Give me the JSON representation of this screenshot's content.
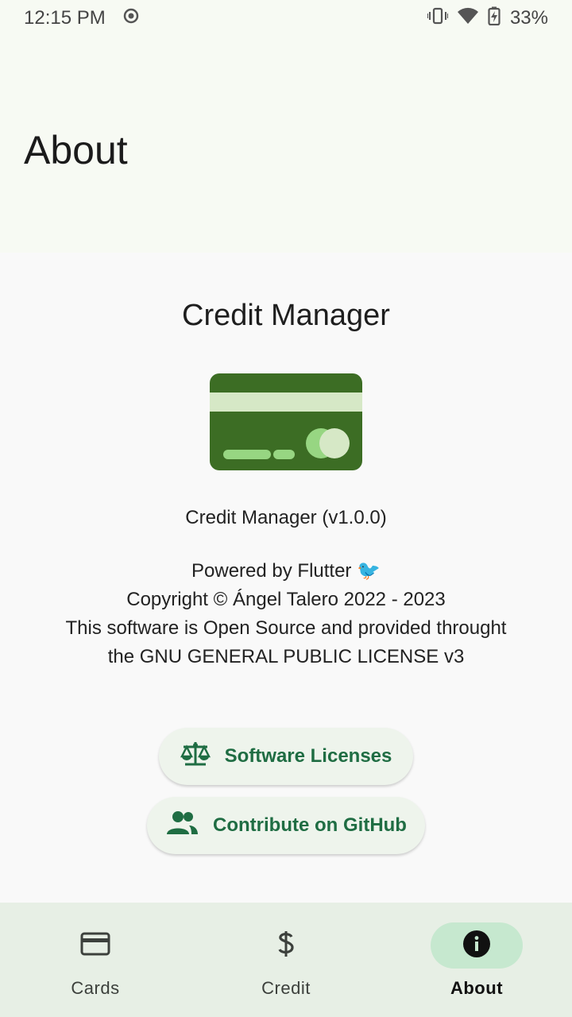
{
  "status_bar": {
    "time": "12:15 PM",
    "battery": "33%"
  },
  "header": {
    "title": "About"
  },
  "about": {
    "app_name": "Credit Manager",
    "version": "Credit Manager (v1.0.0)",
    "lines": [
      "Powered by Flutter 🐦",
      "Copyright © Ángel Talero 2022 - 2023",
      "This software is Open Source and provided throught the GNU GENERAL PUBLIC LICENSE v3"
    ]
  },
  "buttons": {
    "licenses_label": "Software Licenses",
    "github_label": "Contribute on GitHub"
  },
  "nav": {
    "items": [
      {
        "label": "Cards",
        "icon": "credit-card-icon"
      },
      {
        "label": "Credit",
        "icon": "dollar-icon"
      },
      {
        "label": "About",
        "icon": "info-icon"
      }
    ],
    "active": "About"
  },
  "colors": {
    "accent": "#1f6d43",
    "card_dark": "#3c6d24",
    "card_light": "#d6e8c6",
    "nav_active": "#c6e8cf"
  }
}
